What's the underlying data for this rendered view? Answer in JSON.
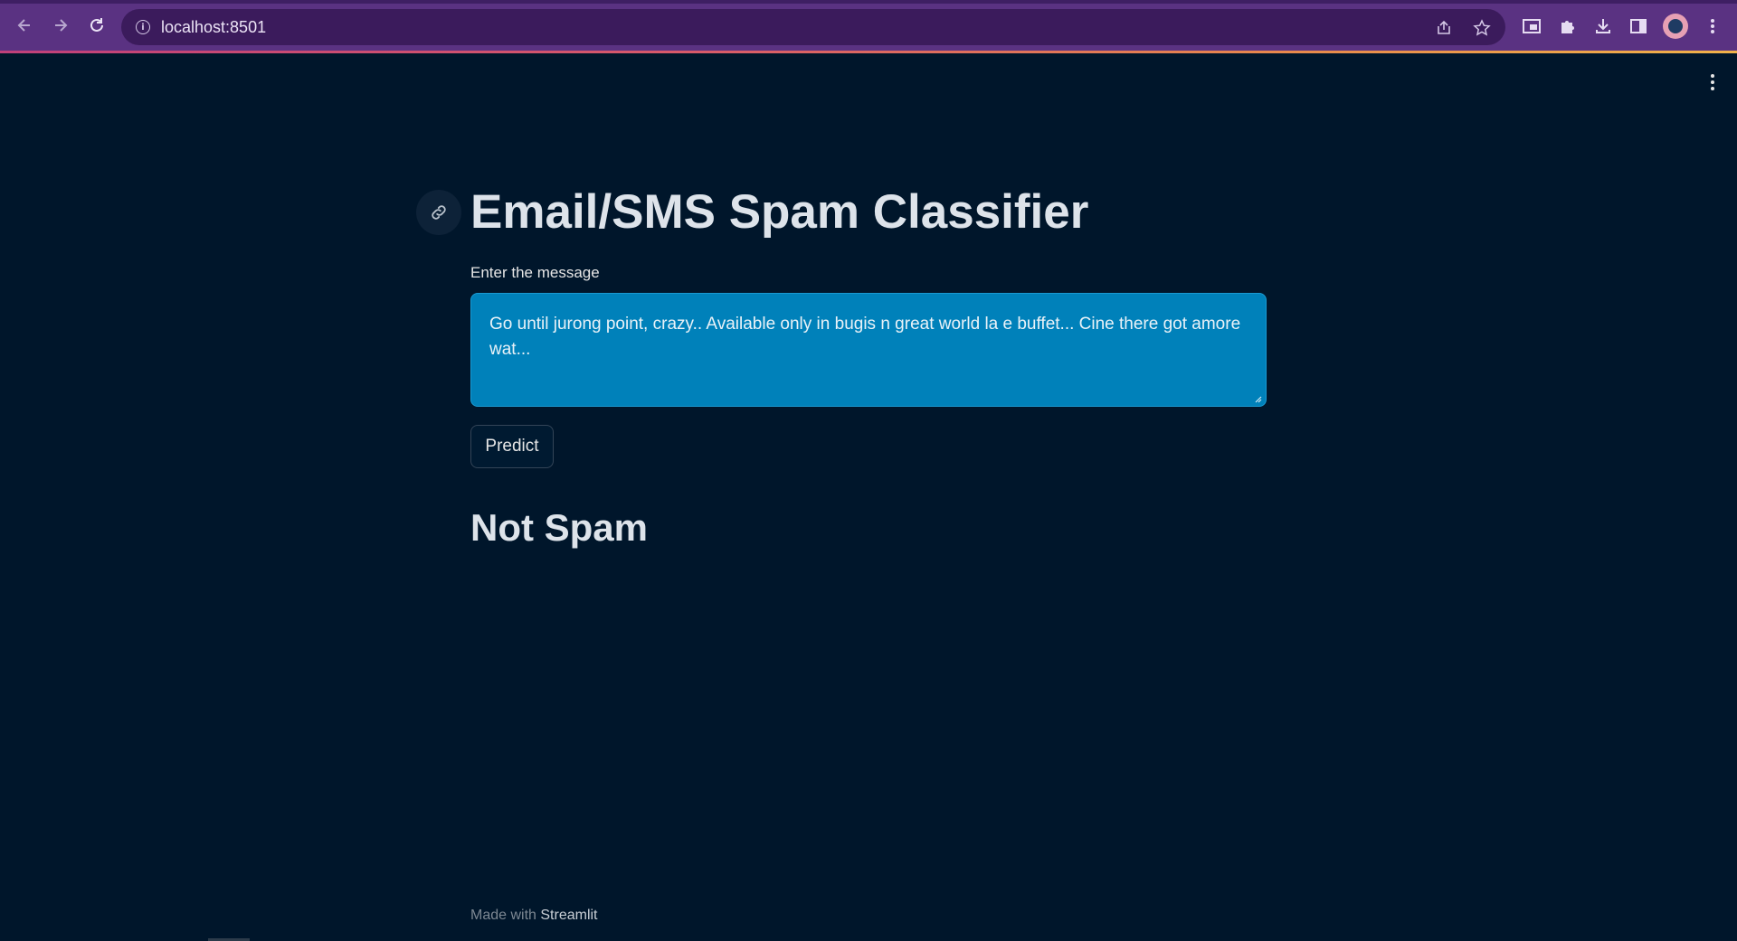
{
  "browser": {
    "url": "localhost:8501"
  },
  "icons": {
    "back": "arrow-left-icon",
    "forward": "arrow-right-icon",
    "reload": "reload-icon",
    "site_info": "info-icon",
    "share": "share-icon",
    "bookmark": "star-icon",
    "extensions": "puzzle-icon",
    "downloads": "download-icon",
    "menu": "vertical-dots-icon"
  },
  "colors": {
    "background": "#00162b",
    "textarea_fill": "#0081ba",
    "chrome": "#5a3282"
  },
  "app": {
    "title": "Email/SMS Spam Classifier",
    "input_label": "Enter the message",
    "input_value": "Go until jurong point, crazy.. Available only in bugis n great world la e buffet... Cine there got amore wat...",
    "predict_label": "Predict",
    "result": "Not Spam"
  },
  "footer": {
    "prefix": "Made with",
    "brand": "Streamlit"
  }
}
